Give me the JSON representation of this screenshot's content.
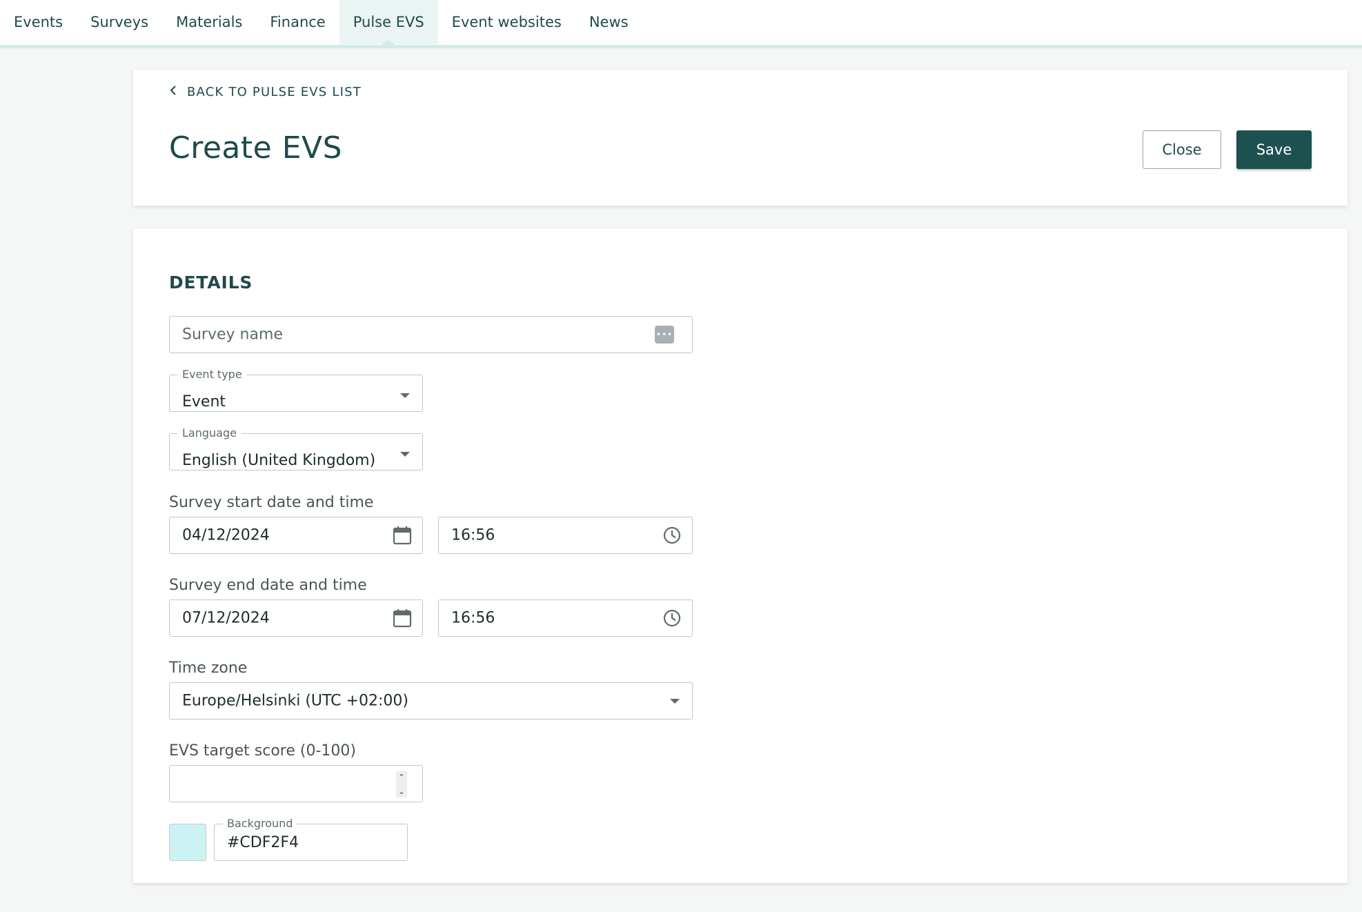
{
  "nav": {
    "items": [
      "Events",
      "Surveys",
      "Materials",
      "Finance",
      "Pulse EVS",
      "Event websites",
      "News"
    ],
    "active_index": 4
  },
  "header": {
    "back_label": "BACK TO PULSE EVS LIST",
    "title": "Create EVS",
    "close_label": "Close",
    "save_label": "Save"
  },
  "details": {
    "section_title": "DETAILS",
    "survey_name_placeholder": "Survey name",
    "event_type": {
      "label": "Event type",
      "value": "Event"
    },
    "language": {
      "label": "Language",
      "value": "English (United Kingdom)"
    },
    "start": {
      "label": "Survey start date and time",
      "date": "04/12/2024",
      "time": "16:56"
    },
    "end": {
      "label": "Survey end date and time",
      "date": "07/12/2024",
      "time": "16:56"
    },
    "timezone": {
      "label": "Time zone",
      "value": "Europe/Helsinki (UTC +02:00)"
    },
    "target_score": {
      "label": "EVS target score (0-100)",
      "value": ""
    },
    "background": {
      "label": "Background",
      "value": "#CDF2F4",
      "color": "#CDF2F4"
    }
  },
  "colors": {
    "accent": "#1d5150",
    "nav_underline": "#d3ebe8",
    "active_tab_bg": "#eaf5f3"
  },
  "icons": [
    "chevron-left-icon",
    "dots-icon",
    "caret-down-icon",
    "calendar-icon",
    "clock-icon",
    "spinner-arrows-icon"
  ]
}
